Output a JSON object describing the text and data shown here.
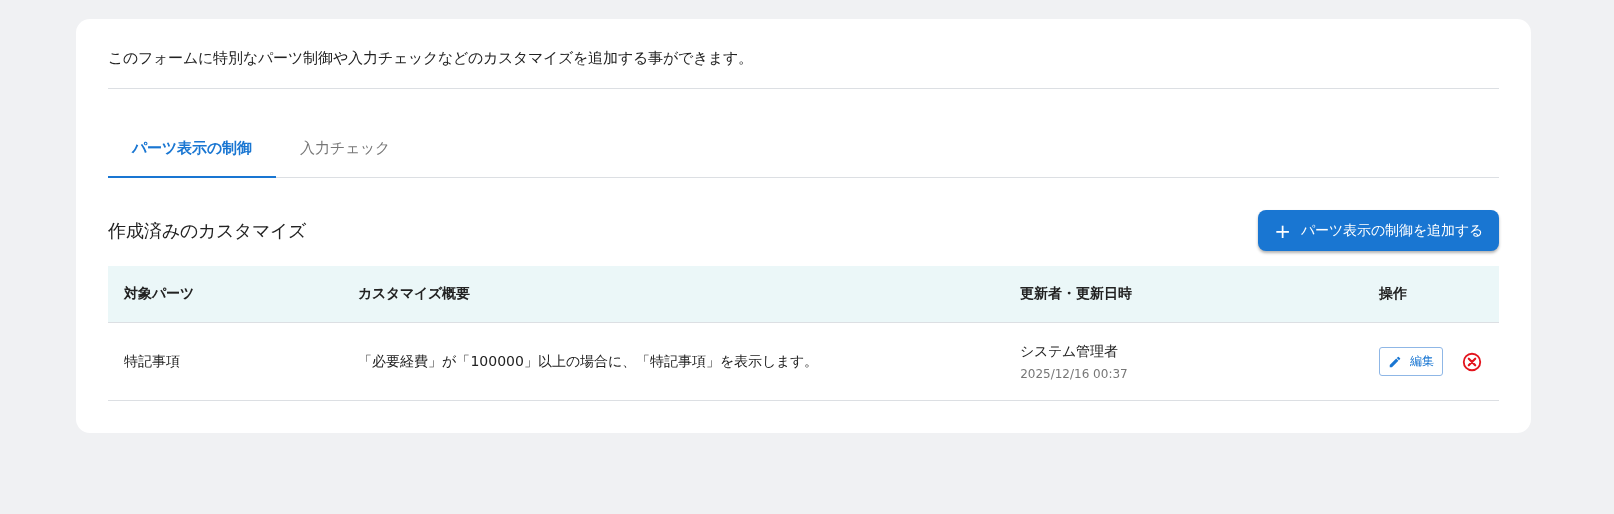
{
  "description": "このフォームに特別なパーツ制御や入力チェックなどのカスタマイズを追加する事ができます。",
  "tabs": [
    {
      "label": "パーツ表示の制御",
      "selected": true
    },
    {
      "label": "入力チェック",
      "selected": false
    }
  ],
  "section_title": "作成済みのカスタマイズ",
  "add_button": {
    "icon": "+",
    "label": "パーツ表示の制御を追加する"
  },
  "table": {
    "columns": [
      "対象パーツ",
      "カスタマイズ概要",
      "更新者・更新日時",
      "操作"
    ],
    "rows": [
      {
        "part": "特記事項",
        "summary": "「必要経費」が「100000」以上の場合に、「特記事項」を表示します。",
        "updater": "システム管理者",
        "updated_at": "2025/12/16 00:37",
        "edit_label": "編集"
      }
    ]
  }
}
